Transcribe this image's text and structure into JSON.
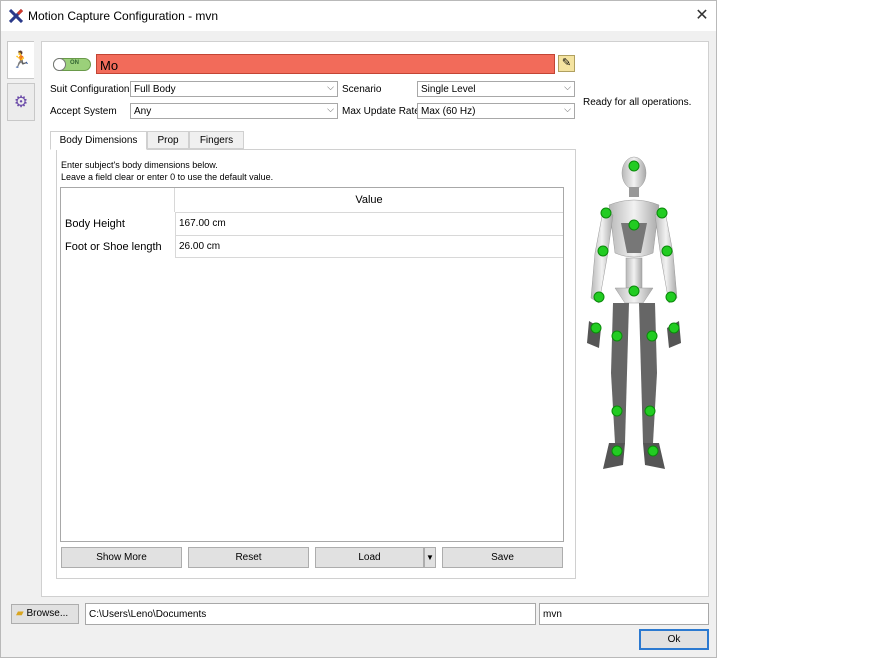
{
  "window": {
    "title": "Motion Capture Configuration - mvn",
    "close_symbol": "✕"
  },
  "toggle": {
    "label": "ON"
  },
  "name_field": {
    "value": "Mo"
  },
  "config": {
    "suit_label": "Suit Configuration",
    "suit_value": "Full Body",
    "scenario_label": "Scenario",
    "scenario_value": "Single Level",
    "accept_label": "Accept System",
    "accept_value": "Any",
    "rate_label": "Max Update Rate",
    "rate_value": "Max (60 Hz)"
  },
  "status_text": "Ready for all operations.",
  "tabs": [
    {
      "label": "Body Dimensions"
    },
    {
      "label": "Prop"
    },
    {
      "label": "Fingers"
    }
  ],
  "instructions": {
    "line1": "Enter subject's body dimensions below.",
    "line2": "Leave a field clear or enter 0 to use the default value."
  },
  "table": {
    "header": "Value",
    "rows": [
      {
        "label": "Body Height",
        "value": "167.00 cm"
      },
      {
        "label": "Foot or Shoe length",
        "value": "26.00 cm"
      }
    ]
  },
  "buttons": {
    "show_more": "Show More",
    "reset": "Reset",
    "load": "Load",
    "save": "Save"
  },
  "bottom": {
    "browse": "Browse...",
    "path": "C:\\Users\\Leno\\Documents",
    "name": "mvn",
    "ok": "Ok"
  },
  "colors": {
    "name_field_bg": "#f26b5a",
    "toggle_on": "#9bd07a",
    "marker": "#22cc22",
    "ok_border": "#2b79d0"
  }
}
